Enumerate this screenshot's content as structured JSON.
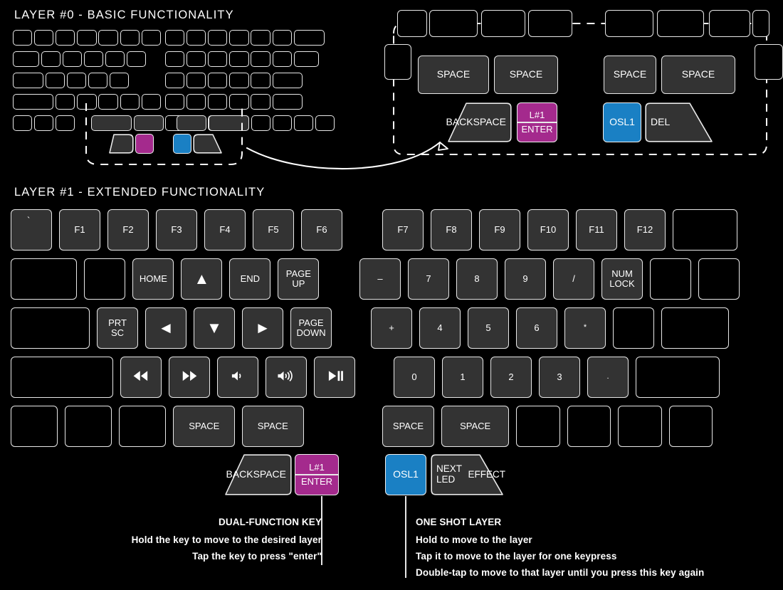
{
  "layer0": {
    "title": "LAYER #0 - BASIC FUNCTIONALITY",
    "thumbs": {
      "backspace_line1": "BACK",
      "backspace_line2": "SPACE"
    }
  },
  "detail": {
    "space": "SPACE",
    "backspace_line1": "BACK",
    "backspace_line2": "SPACE",
    "dual_top": "L#1",
    "dual_bottom": "ENTER",
    "osl": "OSL1",
    "del": "DEL"
  },
  "layer1": {
    "title": "LAYER #1 - EXTENDED FUNCTIONALITY",
    "left": {
      "row1": [
        "`",
        "F1",
        "F2",
        "F3",
        "F4",
        "F5",
        "F6"
      ],
      "row2": [
        "",
        "",
        "HOME",
        "▲",
        "END",
        "PAGE\nUP"
      ],
      "row3": [
        "",
        "PRT\nSC",
        "◄",
        "▼",
        "►",
        "PAGE\nDOWN"
      ],
      "row4": [
        "",
        "rewind-icon",
        "fast-forward-icon",
        "volume-down-icon",
        "volume-up-icon",
        "play-pause-icon"
      ],
      "row5": [
        "",
        "",
        "",
        "SPACE",
        "SPACE"
      ],
      "thumb_backspace_line1": "BACK",
      "thumb_backspace_line2": "SPACE",
      "thumb_dual_top": "L#1",
      "thumb_dual_bottom": "ENTER"
    },
    "right": {
      "row1": [
        "F7",
        "F8",
        "F9",
        "F10",
        "F11",
        "F12",
        ""
      ],
      "row2": [
        "–",
        "7",
        "8",
        "9",
        "/",
        "NUM\nLOCK",
        "",
        ""
      ],
      "row3": [
        "+",
        "4",
        "5",
        "6",
        "*",
        "",
        ""
      ],
      "row4": [
        "0",
        "1",
        "2",
        "3",
        ".",
        ""
      ],
      "row5": [
        "SPACE",
        "SPACE",
        "",
        "",
        "",
        ""
      ],
      "thumb_osl": "OSL1",
      "thumb_led_line1": "NEXT LED",
      "thumb_led_line2": "EFFECT"
    }
  },
  "annotations": {
    "dual": {
      "heading": "DUAL-FUNCTION KEY",
      "line1": "Hold the key to move to the desired layer",
      "line2": "Tap the key to press \"enter\""
    },
    "osl": {
      "heading": "ONE SHOT LAYER",
      "line1": "Hold to move to the layer",
      "line2": "Tap it to move to the layer for one keypress",
      "line3": "Double-tap to move to that layer until you press this key again"
    }
  },
  "colors": {
    "background": "#000000",
    "key_fill": "#333333",
    "key_outline": "#e8e8e8",
    "magenta": "#a42a8d",
    "blue": "#1a80c4",
    "text": "#ffffff"
  }
}
